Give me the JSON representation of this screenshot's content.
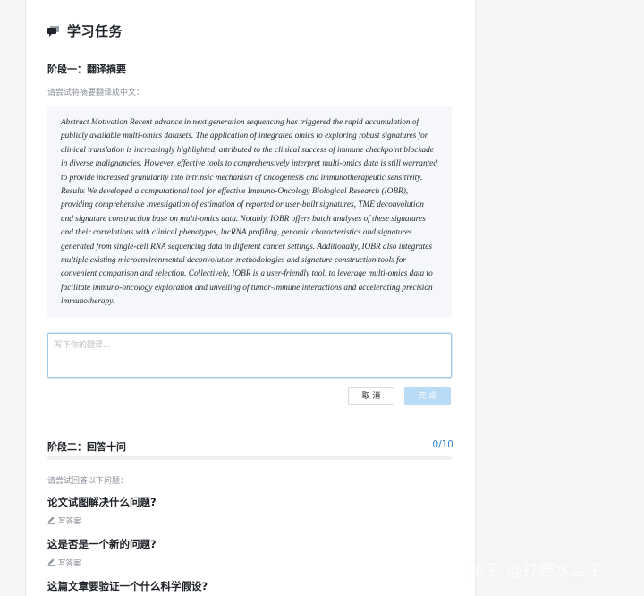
{
  "header": {
    "title": "学习任务",
    "icon": "chat-bubble-icon"
  },
  "stage1": {
    "title": "阶段一：翻译摘要",
    "prompt": "请尝试将摘要翻译成中文：",
    "abstract": "Abstract Motivation Recent advance in next generation sequencing has triggered the rapid accumulation of publicly available multi-omics datasets. The application of integrated omics to exploring robust signatures for clinical translation is increasingly highlighted, attributed to the clinical success of immune checkpoint blockade in diverse malignancies. However, effective tools to comprehensively interpret multi-omics data is still warranted to provide increased granularity into intrinsic mechanism of oncogenesis and immunotherapeutic sensitivity. Results We developed a computational tool for effective Immuno-Oncology Biological Research (IOBR), providing comprehensive investigation of estimation of reported or user-built signatures, TME deconvolution and signature construction base on multi-omics data. Notably, IOBR offers batch analyses of these signatures and their correlations with clinical phenotypes, lncRNA profiling, genomic characteristics and signatures generated from single-cell RNA sequencing data in different cancer settings. Additionally, IOBR also integrates multiple existing microenvironmental deconvolution methodologies and signature construction tools for convenient comparison and selection. Collectively, IOBR is a user-friendly tool, to leverage multi-omics data to facilitate immuno-oncology exploration and unveiling of tumor-immune interactions and accelerating precision immunotherapy.",
    "input_placeholder": "写下你的翻译...",
    "input_value": "",
    "cancel_label": "取 消",
    "done_label": "完 成"
  },
  "stage2": {
    "title": "阶段二：回答十问",
    "progress_text": "0/10",
    "progress_fraction": 0,
    "prompt": "请尝试回答以下问题：",
    "answer_label": "写答案",
    "questions": [
      "论文试图解决什么问题?",
      "这是否是一个新的问题?",
      "这篇文章要验证一个什么科学假设?"
    ]
  },
  "watermark": "知乎 @打野水盆子",
  "colors": {
    "accent": "#2f7fc8",
    "done_button": "#b9dbf5",
    "abstract_bg": "#f5f7fa"
  }
}
